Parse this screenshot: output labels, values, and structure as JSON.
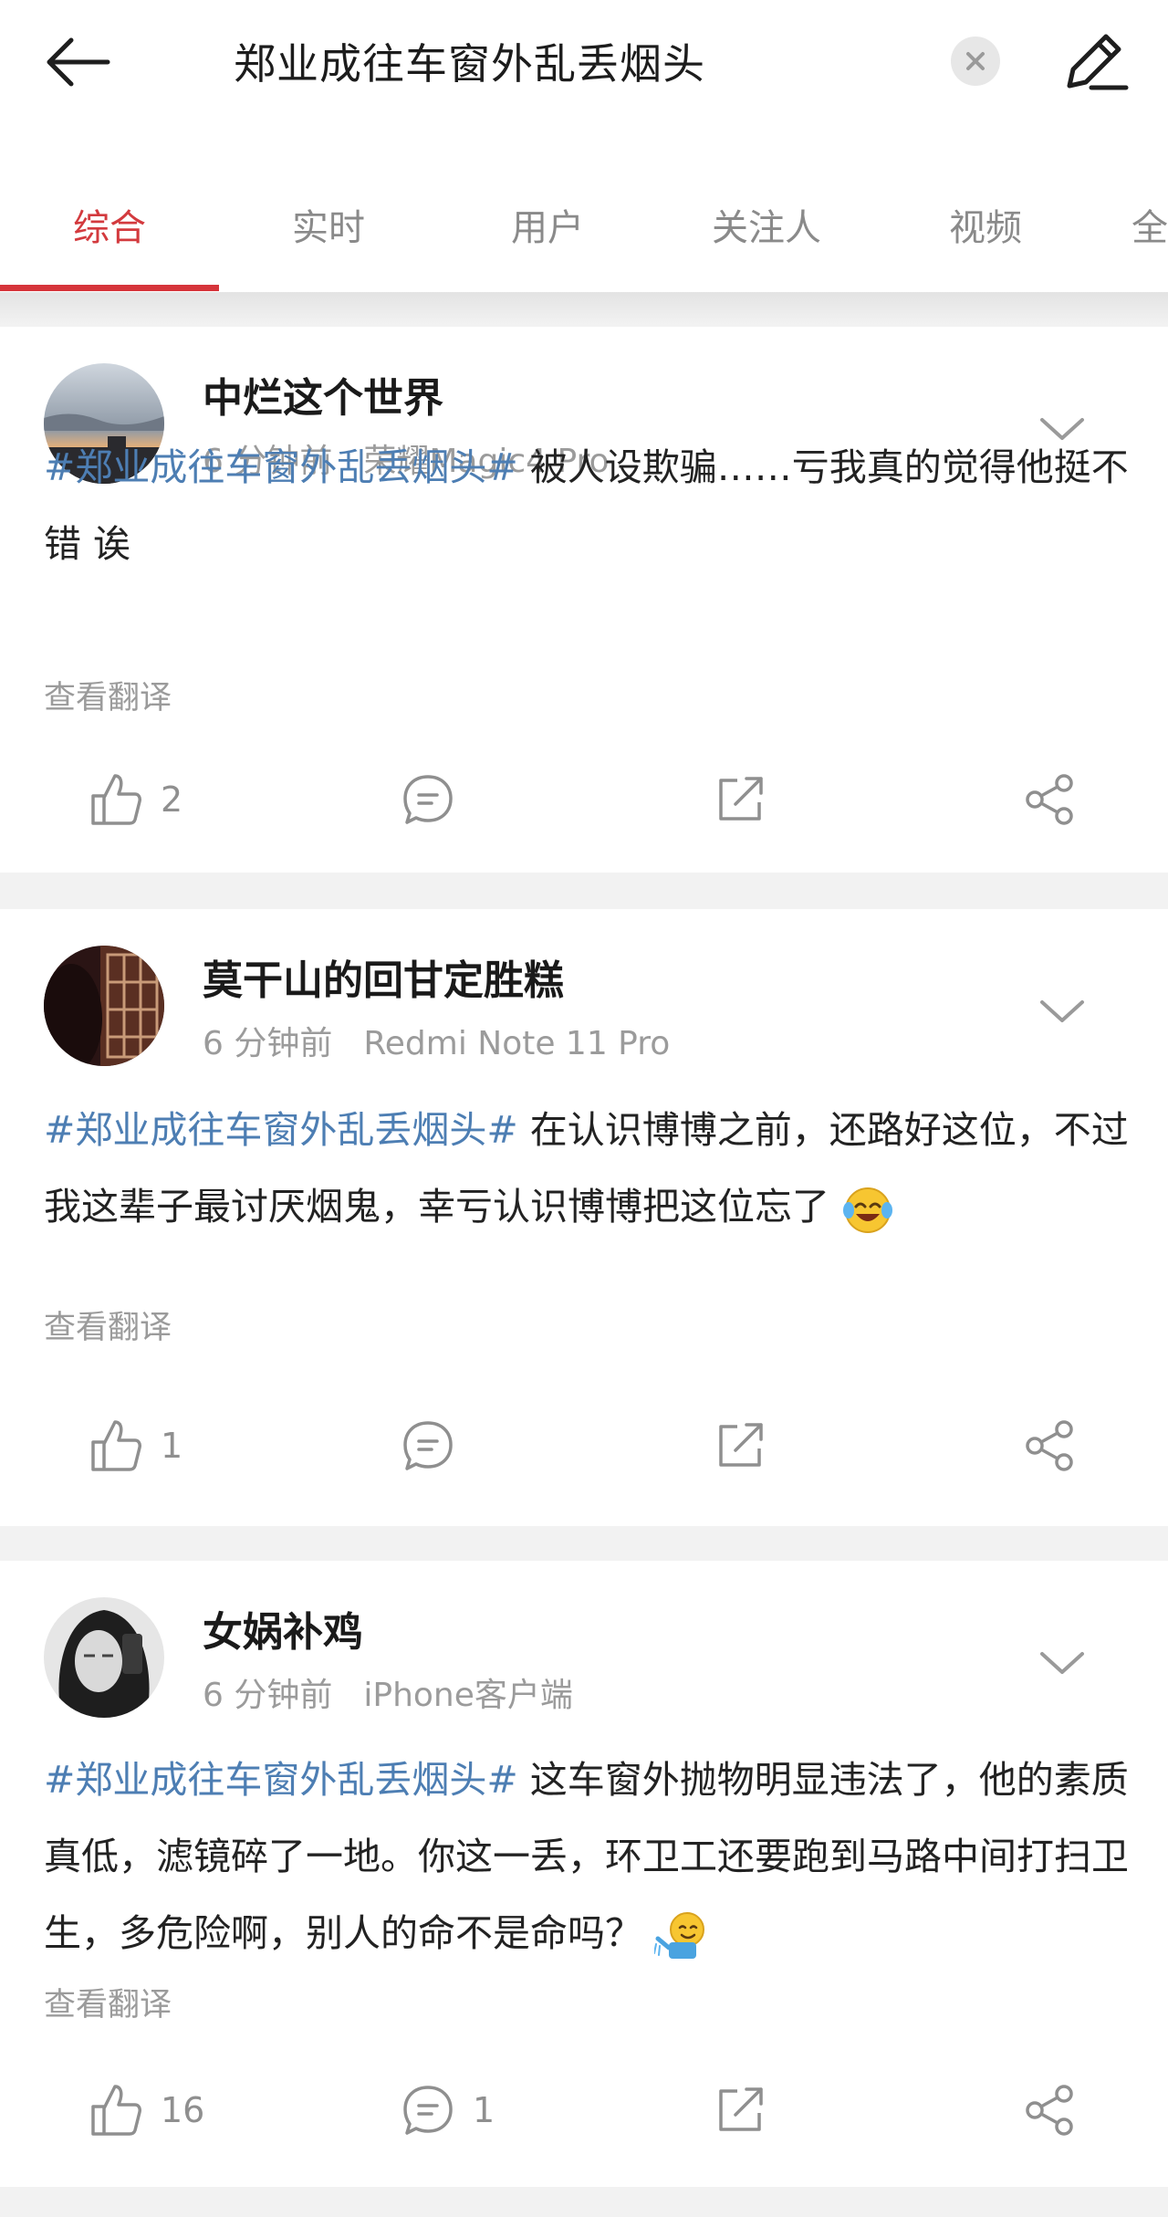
{
  "search": {
    "query": "郑业成往车窗外乱丢烟头"
  },
  "tabs": [
    {
      "label": "综合",
      "active": true
    },
    {
      "label": "实时"
    },
    {
      "label": "用户"
    },
    {
      "label": "关注人"
    },
    {
      "label": "视频"
    },
    {
      "label": "全"
    }
  ],
  "colors": {
    "accent": "#d6343a",
    "hashtag": "#4d7eb3",
    "meta": "#9b9b9b"
  },
  "posts": [
    {
      "username": "中烂这个世界",
      "time": "6 分钟前",
      "source": "荣耀Magic4 Pro",
      "hashtag": "#郑业成往车窗外乱丢烟头#",
      "text": " 被人设欺骗……亏我真的觉得他挺不错 诶",
      "translate": "查看翻译",
      "likes": "2",
      "comments": "",
      "emoji": ""
    },
    {
      "username": "莫干山的回甘定胜糕",
      "time": "6 分钟前",
      "source": "Redmi Note 11 Pro",
      "hashtag": "#郑业成往车窗外乱丢烟头#",
      "text": " 在认识博博之前，还路好这位，不过我这辈子最讨厌烟鬼，幸亏认识博博把这位忘了",
      "translate": "查看翻译",
      "likes": "1",
      "comments": "",
      "emoji": "laughing-crying-emoji"
    },
    {
      "username": "女娲补鸡",
      "time": "6 分钟前",
      "source": "iPhone客户端",
      "hashtag": "#郑业成往车窗外乱丢烟头#",
      "text": " 这车窗外抛物明显违法了，他的素质真低，滤镜碎了一地。你这一丢，环卫工还要跑到马路中间打扫卫生，多危险啊，别人的命不是命吗？",
      "translate": "查看翻译",
      "likes": "16",
      "comments": "1",
      "emoji": "watering-can-emoji"
    }
  ]
}
